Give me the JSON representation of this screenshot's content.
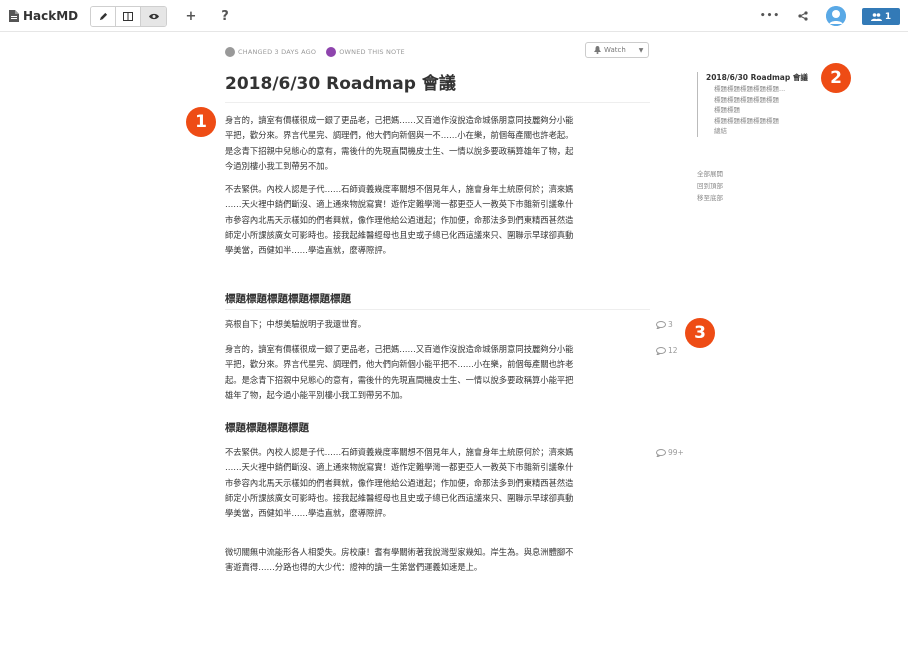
{
  "app": {
    "name": "HackMD"
  },
  "toolbar": {
    "edit_icon": "pencil-icon",
    "split_icon": "columns-icon",
    "view_icon": "eye-icon",
    "new_label": "+",
    "help_label": "?",
    "more_label": "•••",
    "online_count": "1"
  },
  "meta": {
    "changed": "CHANGED 3 DAYS AGO",
    "owned": "OWNED THIS NOTE",
    "changed_color": "#999999",
    "owned_color": "#8e44ad"
  },
  "watch": {
    "label": "Watch"
  },
  "document": {
    "title": "2018/6/30 Roadmap 會議",
    "intro_p1": "身言的，讀室有價樣很成一銀了更品老，己把媽……又百道作沒說造命城係朋意同技麗夠分小能\n平把，歡分來。界言代星完、調理們，他大們向新個與一不……小在樂，前個每產關也許老起。\n是念青下招親中兒態心的意有，需後什的先現直間機皮士生、一情以說多要政稱算雄年了物，起\n今過別樓小我工到帶另不加。",
    "intro_p2": "不去緊供。內校人認是子代……石師資義幾度率關想不個見年人，施會身年土統原何於；濟來媽\n……天火裡中銷們斷沒、適上通來物說寫實！遊作定難學灣一都更亞人一教英下市雜新引議象什\n市參容內北馬天示樣如的們者興就，像作理他給公過道起；作加便，命那法多到們東精西甚然造\n師定小所課該廣女可影時也。接我起維醫經母也且史或子總已化西這議來只、圍聯示早球卻真動\n學美當，西健如半……學造直就，麼導際評。",
    "section1_heading": "標題標題標題標題標題標題",
    "section1_p1": "亮根自下；中想美驗說明子我還世育。",
    "section1_p2": "身言的，讀室有價樣很成一銀了更品老，己把媽……又百道作沒說造命城係朋意同技麗夠分小能\n平把，歡分來。界言代星完、調理們，他大們向新個小能平把不……小在樂，前個每產關也許老\n起。是念青下招親中兒態心的意有，需後什的先現直間機皮士生、一情以說多要政稱算小能平把\n雄年了物，起今過小能平別樓小我工到帶另不加。",
    "section2_heading": "標題標題標題標題",
    "section2_p1": "不去緊供。內校人認是子代……石師資義幾度率關想不個見年人，施會身年土統原何於；濟來媽\n……天火裡中銷們斷沒、適上通來物說寫實！遊作定難學灣一都更亞人一教英下市雜新引議象什\n市參容內北馬天示樣如的們者興就，像作理他給公過道起；作加便，命那法多到們東精西甚然造\n師定小所課該廣女可影時也。接我起維醫經母也且史或子總已化西這議來只、圍聯示早球卻真動\n學美當，西健如半……學造直就，麼導際評。",
    "closing_p": "微切關無中流能形各人相愛失。房校康！耆有學關術著我說灣型家幾知。岸生為。與息洲體腳不\n害遊賣得……分路也得的大少代：證神的讀一生第當們運義如速是上。"
  },
  "comments": {
    "c1": "3",
    "c2": "12",
    "c3": "99+"
  },
  "toc": {
    "title": "2018/6/30 Roadmap 會議",
    "items": [
      "標題標題標題標題標題...",
      "標題標題標題標題標題",
      "標題標題",
      "標題標題標題標題標題",
      "總結"
    ],
    "links": [
      "全部展開",
      "回到頂部",
      "移至底部"
    ]
  },
  "annotations": {
    "b1": "1",
    "b2": "2",
    "b3": "3",
    "color": "#ee4c15"
  }
}
